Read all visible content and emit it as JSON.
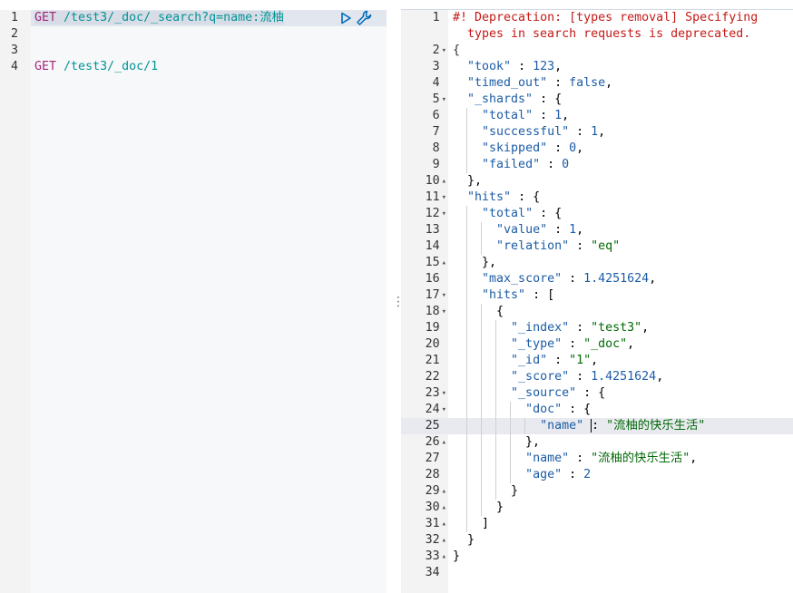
{
  "request_editor": {
    "lines": [
      {
        "no": "1",
        "method": "GET",
        "path": "/test3/_doc/_search?q=name:流柚",
        "active": true
      },
      {
        "no": "2",
        "method": "",
        "path": ""
      },
      {
        "no": "3",
        "method": "",
        "path": ""
      },
      {
        "no": "4",
        "method": "GET",
        "path": "/test3/_doc/1"
      }
    ],
    "actions": {
      "run_icon": "play-icon",
      "settings_icon": "wrench-icon"
    }
  },
  "resizer": {
    "icon": "vertical-dots-icon"
  },
  "response_editor": {
    "warning": "#! Deprecation: [types removal] Specifying",
    "warning_cont": "types in search requests is deprecated.",
    "line_numbers": [
      "1",
      "",
      "2",
      "3",
      "4",
      "5",
      "6",
      "7",
      "8",
      "9",
      "10",
      "11",
      "12",
      "13",
      "14",
      "15",
      "16",
      "17",
      "18",
      "19",
      "20",
      "21",
      "22",
      "23",
      "24",
      "25",
      "26",
      "27",
      "28",
      "29",
      "30",
      "31",
      "32",
      "33",
      "34"
    ],
    "took": "123",
    "timed_out": "false",
    "shards": {
      "total": "1",
      "successful": "1",
      "skipped": "0",
      "failed": "0"
    },
    "hits_total": {
      "value": "1",
      "relation": "\"eq\""
    },
    "max_score": "1.4251624",
    "hit": {
      "index": "\"test3\"",
      "type": "\"_doc\"",
      "id": "\"1\"",
      "score": "1.4251624",
      "doc_name": "\"流柚的快乐生活\"",
      "name": "\"流柚的快乐生活\"",
      "age": "2"
    },
    "keys": {
      "took": "\"took\"",
      "timed_out": "\"timed_out\"",
      "shards": "\"_shards\"",
      "total": "\"total\"",
      "successful": "\"successful\"",
      "skipped": "\"skipped\"",
      "failed": "\"failed\"",
      "hits": "\"hits\"",
      "value": "\"value\"",
      "relation": "\"relation\"",
      "max_score": "\"max_score\"",
      "index": "\"_index\"",
      "type": "\"_type\"",
      "id": "\"_id\"",
      "score": "\"_score\"",
      "source": "\"_source\"",
      "doc": "\"doc\"",
      "name": "\"name\"",
      "age": "\"age\""
    }
  },
  "colors": {
    "method": "#a0297c",
    "url": "#009496",
    "key": "#1c5ca6",
    "string": "#036a07",
    "warning": "#c41a16"
  }
}
